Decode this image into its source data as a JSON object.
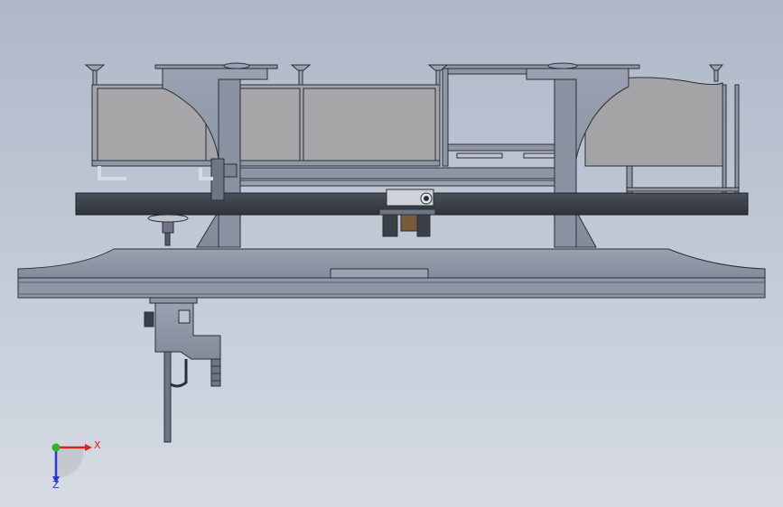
{
  "viewport": {
    "background_top": "#aeb8c8",
    "background_bottom": "#d6dbe4"
  },
  "triad": {
    "x_label": "X",
    "z_label": "Z",
    "x_color": "#e0201a",
    "y_color": "#2bb52b",
    "z_color": "#2a3ac8"
  },
  "model": {
    "steel_color": "#8f97a7",
    "panel_color": "#a4a4a6",
    "line_color": "#2a2e36"
  }
}
